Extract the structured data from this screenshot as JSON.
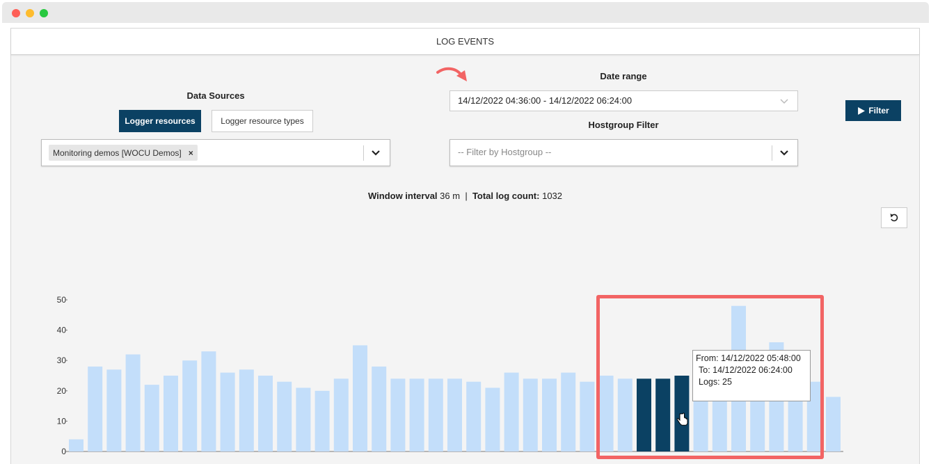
{
  "window": {
    "controls": [
      {
        "name": "close",
        "color": "#fe5f57"
      },
      {
        "name": "minimize",
        "color": "#febc2e"
      },
      {
        "name": "zoom",
        "color": "#28c840"
      }
    ]
  },
  "panel": {
    "title": "LOG EVENTS"
  },
  "data_sources": {
    "title": "Data Sources",
    "tab_active": "Logger resources",
    "tab_inactive": "Logger resource types",
    "selected_tag": "Monitoring demos [WOCU Demos]",
    "tag_remove_icon": "×"
  },
  "date_range": {
    "title": "Date range",
    "value": "14/12/2022 04:36:00 - 14/12/2022 06:24:00"
  },
  "hostgroup": {
    "title": "Hostgroup Filter",
    "placeholder": "-- Filter by Hostgroup --"
  },
  "filter_button": {
    "label": "Filter",
    "icon": "play-icon"
  },
  "summary": {
    "window_interval_label": "Window interval",
    "window_interval_value": "36 m",
    "separator": "|",
    "total_label": "Total log count:",
    "total_value": "1032"
  },
  "reset_button": {
    "icon": "undo-icon"
  },
  "tooltip": {
    "from": "From: 14/12/2022 05:48:00",
    "to": "To: 14/12/2022 06:24:00",
    "logs": "Logs: 25"
  },
  "colors": {
    "accent": "#0b4163",
    "bar": "#c3defa",
    "bar_selected": "#0b4163",
    "highlight": "#f26464",
    "arrow": "#f26464"
  },
  "chart_data": {
    "type": "bar",
    "yticks": [
      0,
      10,
      20,
      30,
      40,
      50
    ],
    "ylim": [
      0,
      50
    ],
    "values": [
      4,
      28,
      27,
      32,
      22,
      25,
      30,
      33,
      26,
      27,
      25,
      23,
      21,
      20,
      24,
      35,
      28,
      24,
      24,
      24,
      24,
      23,
      21,
      26,
      24,
      24,
      26,
      23,
      25,
      24,
      24,
      24,
      25,
      24,
      24,
      48,
      24,
      36,
      24,
      23,
      18
    ],
    "selected_indices": [
      30,
      31,
      32
    ]
  }
}
